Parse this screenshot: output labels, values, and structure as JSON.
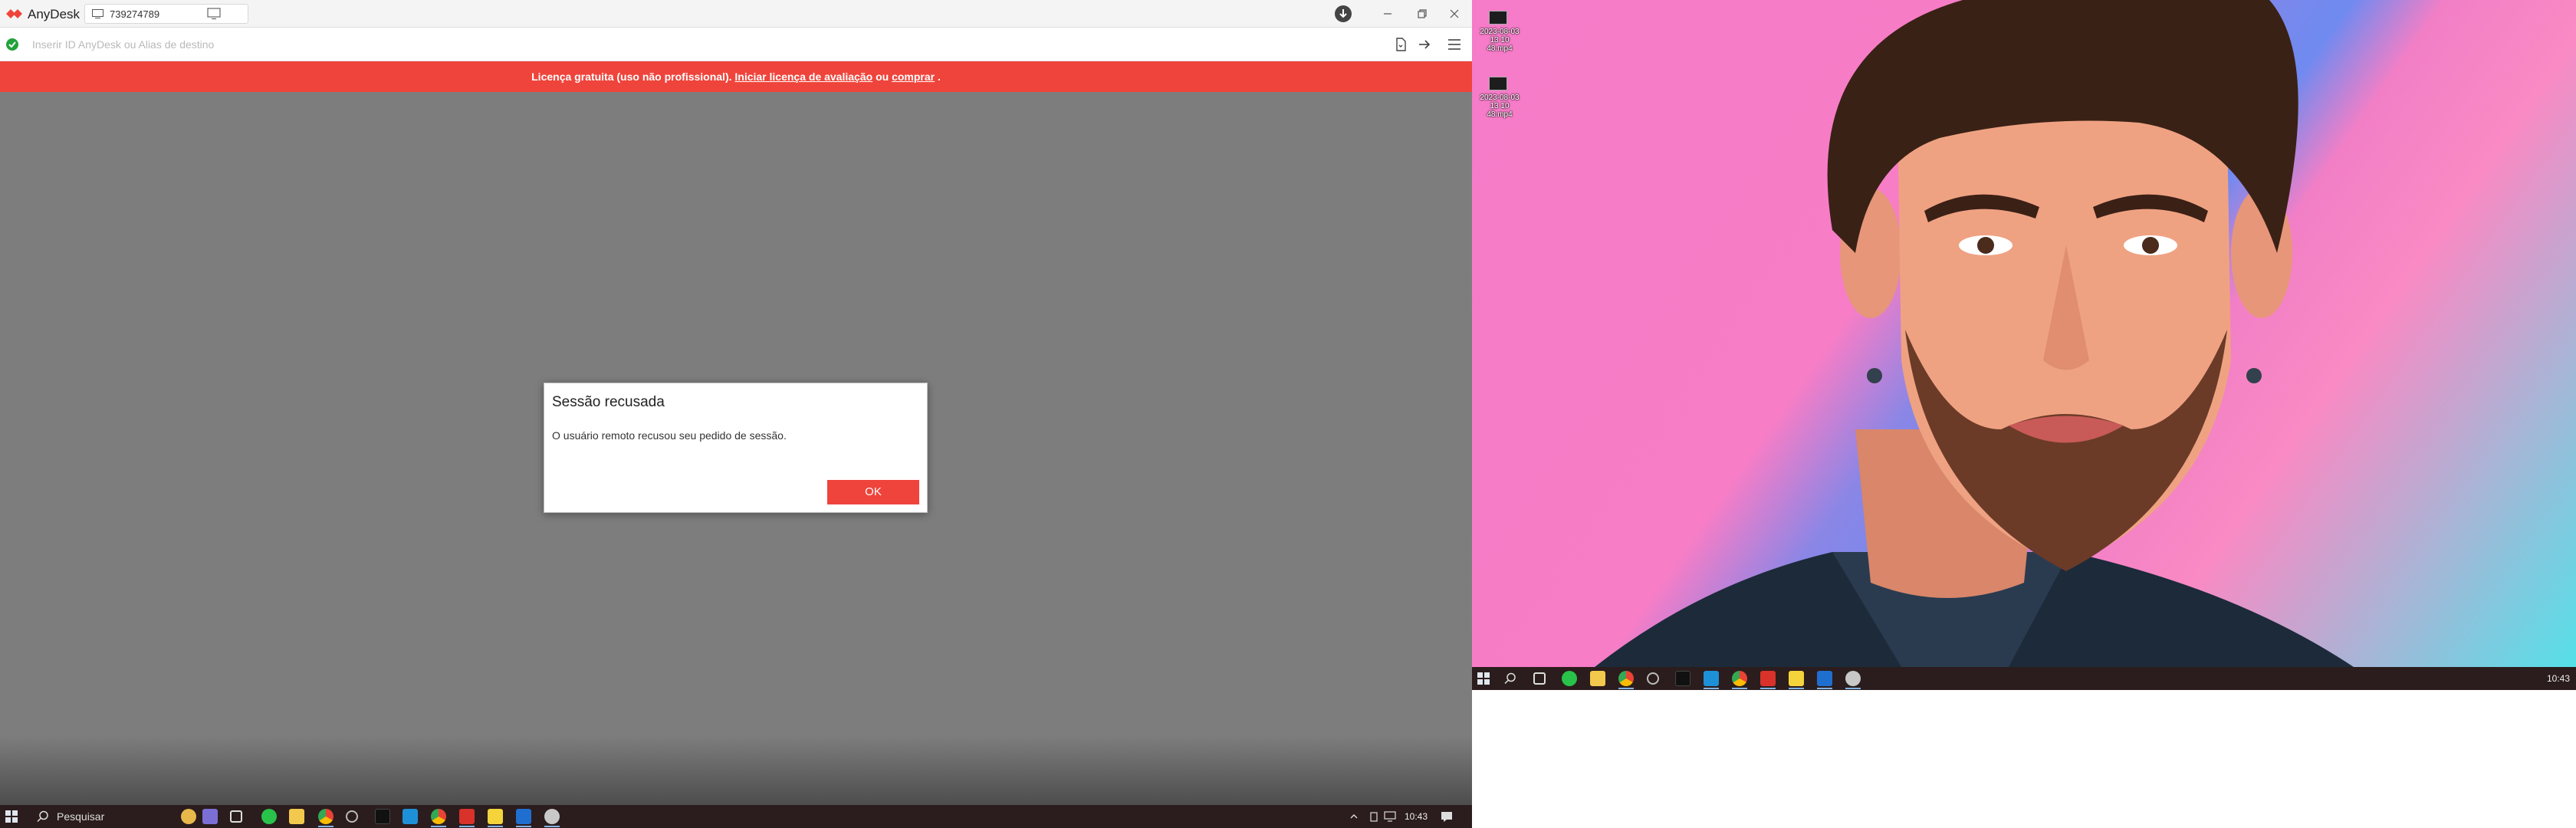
{
  "anydesk": {
    "app_name": "AnyDesk",
    "tab_id": "739274789",
    "address_placeholder": "Inserir ID AnyDesk ou Alias de destino",
    "banner": {
      "text": "Licença gratuita (uso não profissional).",
      "trial_link": "Iniciar licença de avaliação",
      "or_text": "ou",
      "buy_link": "comprar",
      "end_text": "."
    },
    "dialog": {
      "title": "Sessão recusada",
      "message": "O usuário remoto recusou seu pedido de sessão.",
      "ok_label": "OK"
    },
    "colors": {
      "accent": "#ef443b",
      "background": "#7d7d7d",
      "status_ok": "#23a23a"
    }
  },
  "taskbar_left": {
    "search_label": "Pesquisar",
    "clock": "10:43",
    "apps": [
      "widgets-icon",
      "teams-icon",
      "task-view-icon",
      "whatsapp-icon",
      "file-explorer-icon",
      "chrome-icon",
      "clock-app-icon",
      "tiktok-icon",
      "skype-icon",
      "chrome-profile-icon",
      "anydesk-icon",
      "sticky-notes-icon",
      "outlook-icon",
      "remote-app-icon"
    ]
  },
  "right_desktop": {
    "icons": [
      {
        "caption": "2023-08-03 13 10 48.mp4"
      },
      {
        "caption": "2023-08-03 13 10 48.mp4"
      }
    ],
    "clock": "10:43"
  }
}
